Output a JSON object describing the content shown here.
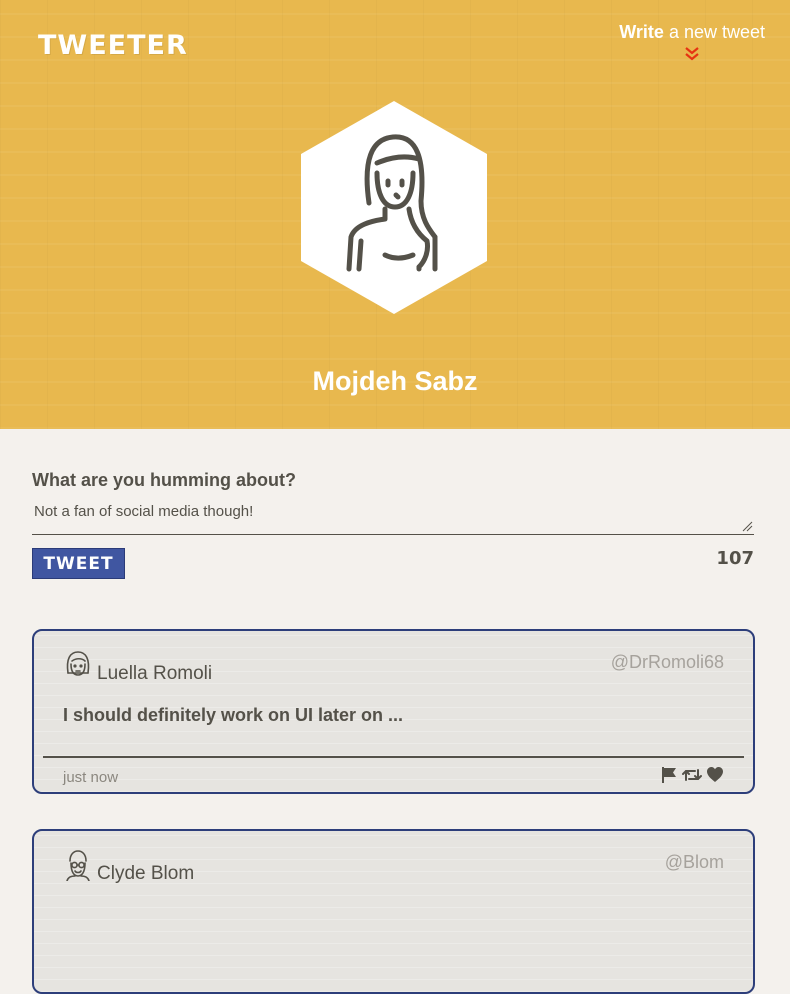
{
  "header": {
    "brand": "TWEETER",
    "compose_link": {
      "bold": "Write",
      "rest": "a new tweet"
    }
  },
  "profile": {
    "name": "Mojdeh Sabz"
  },
  "composer": {
    "label": "What are you humming about?",
    "value": "Not a fan of social media though!",
    "button_label": "TWEET",
    "counter": "107"
  },
  "tweets": [
    {
      "name": "Luella Romoli",
      "handle": "@DrRomoli68",
      "text": "I should definitely work on UI later on ...",
      "time": "just now"
    },
    {
      "name": "Clyde Blom",
      "handle": "@Blom",
      "text": "",
      "time": ""
    }
  ],
  "colors": {
    "header_bg": "#e8b84e",
    "page_bg": "#f4f1ed",
    "accent_blue": "#4056a1",
    "chevron_red": "#e63312",
    "text": "#545149"
  },
  "icons": [
    "double-chevron-down-icon",
    "user-avatar-icon",
    "flag-icon",
    "retweet-icon",
    "heart-icon",
    "resize-handle-icon"
  ]
}
